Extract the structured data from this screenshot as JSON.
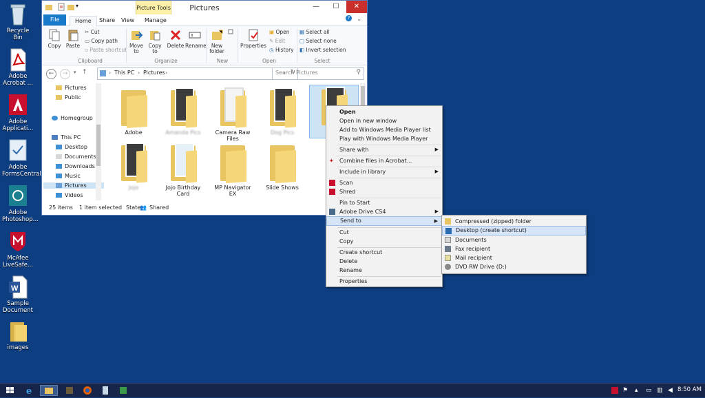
{
  "desktop": {
    "icons": [
      {
        "label": "Recycle Bin",
        "icon": "recycle-bin-icon"
      },
      {
        "label": "Adobe Acrobat ...",
        "icon": "pdf-icon"
      },
      {
        "label": "Adobe Applicati...",
        "icon": "adobe-icon"
      },
      {
        "label": "Adobe FormsCentral",
        "icon": "forms-icon"
      },
      {
        "label": "Adobe Photoshop...",
        "icon": "photoshop-icon"
      },
      {
        "label": "McAfee LiveSafe...",
        "icon": "mcafee-icon"
      },
      {
        "label": "Sample Document",
        "icon": "word-icon"
      },
      {
        "label": "images",
        "icon": "folder-icon"
      }
    ]
  },
  "window": {
    "title": "Pictures",
    "context_tab": "Picture Tools",
    "tabs": [
      "File",
      "Home",
      "Share",
      "View",
      "Manage"
    ],
    "ribbon": {
      "clipboard": {
        "copy": "Copy",
        "paste": "Paste",
        "cut": "Cut",
        "copy_path": "Copy path",
        "paste_shortcut": "Paste shortcut",
        "label": "Clipboard"
      },
      "organize": {
        "move_to": "Move to",
        "copy_to": "Copy to",
        "delete": "Delete",
        "rename": "Rename",
        "label": "Organize"
      },
      "new": {
        "new_folder": "New folder",
        "label": "New"
      },
      "open": {
        "properties": "Properties",
        "open": "Open",
        "edit": "Edit",
        "history": "History",
        "label": "Open"
      },
      "select": {
        "select_all": "Select all",
        "select_none": "Select none",
        "invert": "Invert selection",
        "label": "Select"
      }
    },
    "address": {
      "crumbs": [
        "This PC",
        "Pictures"
      ],
      "search_placeholder": "Search Pictures"
    },
    "nav_pane": [
      {
        "label": "Pictures",
        "type": "folder"
      },
      {
        "label": "Public",
        "type": "folder"
      },
      {
        "label": "Homegroup",
        "type": "homegroup"
      },
      {
        "label": "This PC",
        "type": "pc"
      },
      {
        "label": "Desktop",
        "type": "folder"
      },
      {
        "label": "Documents",
        "type": "folder"
      },
      {
        "label": "Downloads",
        "type": "folder"
      },
      {
        "label": "Music",
        "type": "folder"
      },
      {
        "label": "Pictures",
        "type": "folder",
        "selected": true
      },
      {
        "label": "Videos",
        "type": "folder"
      }
    ],
    "folders": [
      {
        "label": "Adobe"
      },
      {
        "label": "Amanda Pics"
      },
      {
        "label": "Camera Raw Files"
      },
      {
        "label": "Dog Pics"
      },
      {
        "label": "gr"
      },
      {
        "label": "Jojo"
      },
      {
        "label": "Jojo Birthday Card"
      },
      {
        "label": "MP Navigator EX"
      },
      {
        "label": "Slide Shows"
      }
    ],
    "status": {
      "items": "25 items",
      "selected": "1 item selected",
      "state_label": "State:",
      "state_value": "Shared"
    }
  },
  "context_menu": {
    "items": [
      "Open",
      "Open in new window",
      "Add to Windows Media Player list",
      "Play with Windows Media Player",
      "Share with",
      "Combine files in Acrobat...",
      "Include in library",
      "Scan",
      "Shred",
      "Pin to Start",
      "Adobe Drive CS4",
      "Send to",
      "Cut",
      "Copy",
      "Create shortcut",
      "Delete",
      "Rename",
      "Properties"
    ]
  },
  "send_to_menu": {
    "items": [
      "Compressed (zipped) folder",
      "Desktop (create shortcut)",
      "Documents",
      "Fax recipient",
      "Mail recipient",
      "DVD RW Drive (D:)"
    ]
  },
  "taskbar": {
    "clock": "8:50 AM"
  }
}
